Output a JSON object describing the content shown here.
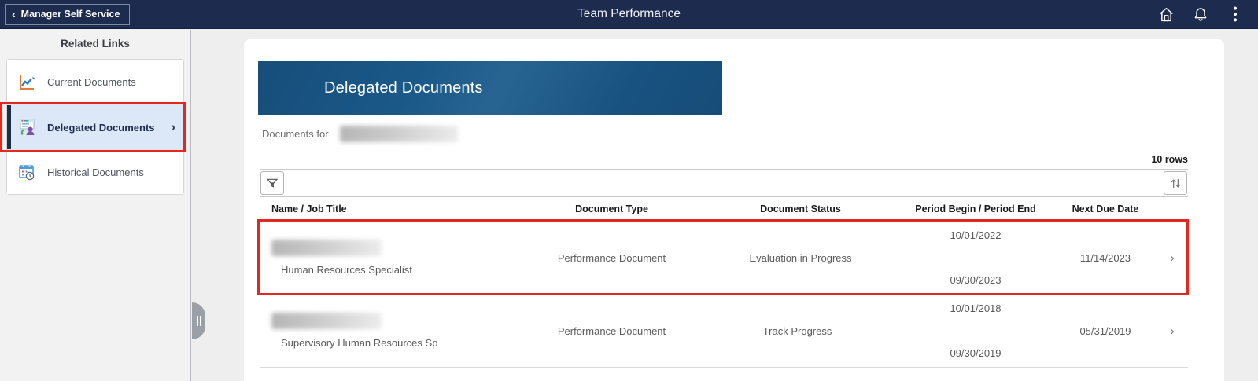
{
  "header": {
    "back_label": "Manager Self Service",
    "back_chevron": "‹",
    "title": "Team Performance",
    "icons": [
      "home-icon",
      "notifications-bell-icon",
      "more-kebab-icon"
    ]
  },
  "sidebar": {
    "heading": "Related Links",
    "items": [
      {
        "label": "Current Documents",
        "icon": "line-chart-icon",
        "selected": false
      },
      {
        "label": "Delegated Documents",
        "icon": "delegated-person-icon",
        "selected": true,
        "annotated": true,
        "chevron": "›"
      },
      {
        "label": "Historical Documents",
        "icon": "calendar-clock-icon",
        "selected": false
      }
    ]
  },
  "main": {
    "banner_title": "Delegated Documents",
    "documents_for_label": "Documents for",
    "documents_for_name_redacted": true,
    "row_count_label": "10 rows",
    "toolbar": {
      "filter_icon": "filter-funnel-icon",
      "sort_icon": "sort-arrows-icon"
    },
    "table": {
      "columns": [
        "Name / Job Title",
        "Document Type",
        "Document Status",
        "Period Begin / Period End",
        "Next Due Date"
      ],
      "row_chevron": "›",
      "rows": [
        {
          "name_redacted": true,
          "job_title": "Human Resources Specialist",
          "document_type": "Performance Document",
          "document_status": "Evaluation in Progress",
          "period_begin": "10/01/2022",
          "period_end": "09/30/2023",
          "next_due_date": "11/14/2023",
          "highlighted": true
        },
        {
          "name_redacted": true,
          "job_title": "Supervisory Human Resources Sp",
          "document_type": "Performance Document",
          "document_status": "Track Progress -",
          "period_begin": "10/01/2018",
          "period_end": "09/30/2019",
          "next_due_date": "05/31/2019",
          "highlighted": false
        }
      ]
    }
  },
  "colors": {
    "header_bg": "#1c2b4e",
    "banner_bg": "#1b5b8c",
    "selected_item_bg": "#dce8f7",
    "annotation_red": "#e3291f",
    "sidebar_bg": "#f3f2f2"
  }
}
